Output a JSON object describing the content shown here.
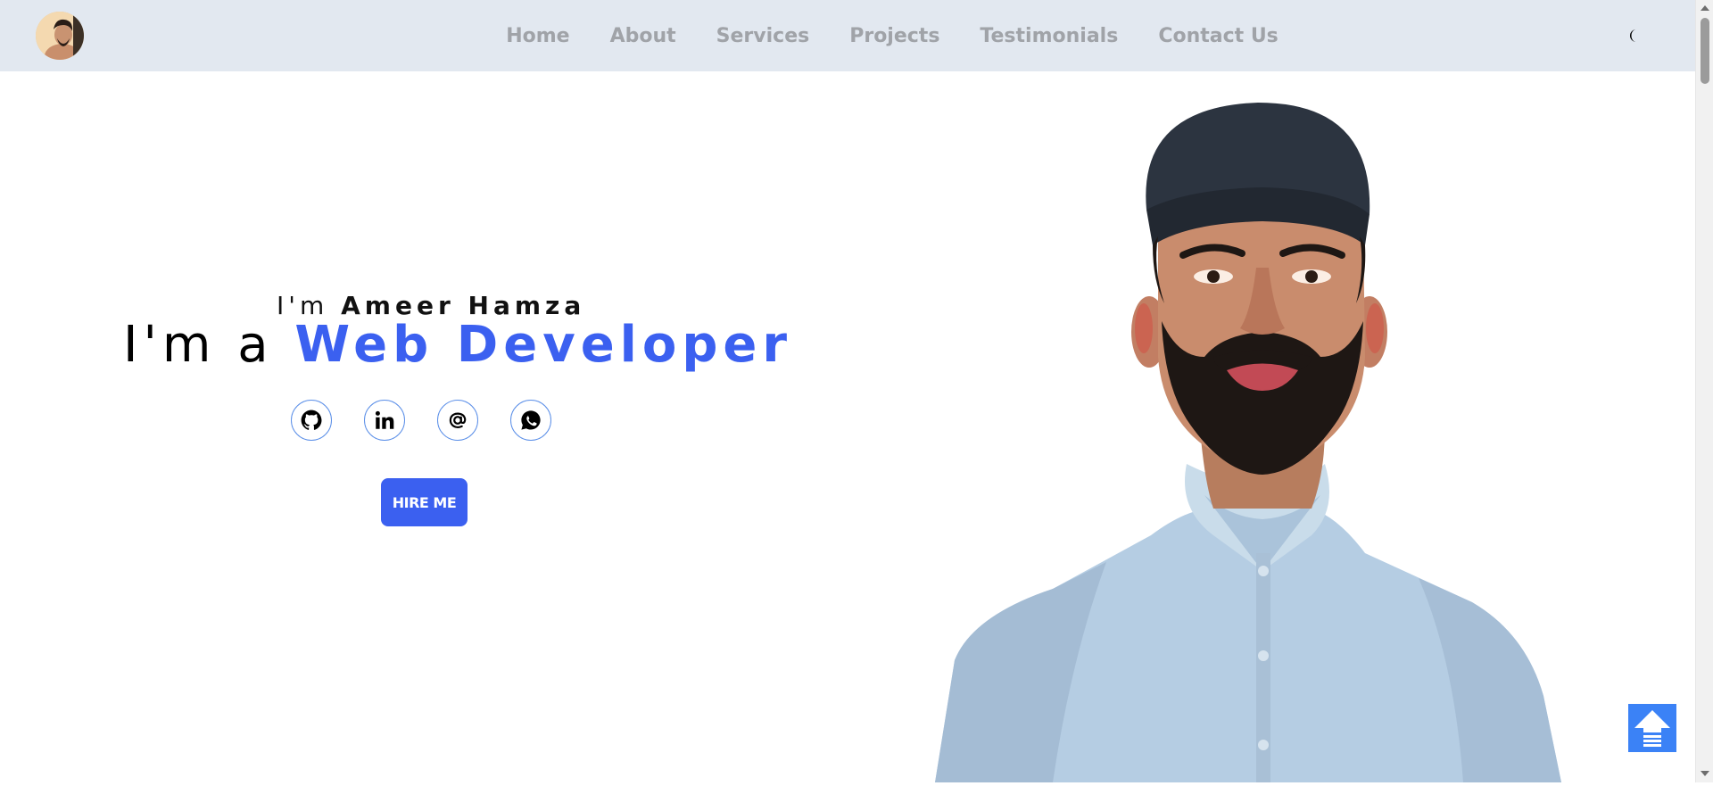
{
  "header": {
    "nav": [
      {
        "label": "Home"
      },
      {
        "label": "About"
      },
      {
        "label": "Services"
      },
      {
        "label": "Projects"
      },
      {
        "label": "Testimonials"
      },
      {
        "label": "Contact Us"
      }
    ],
    "theme_icon": "moon-icon",
    "avatar_icon": "profile-avatar"
  },
  "hero": {
    "greeting_prefix": "I'm",
    "name": "Ameer Hamza",
    "headline_prefix": "I'm a",
    "role": "Web Developer",
    "socials": [
      {
        "icon": "github-icon"
      },
      {
        "icon": "linkedin-icon"
      },
      {
        "icon": "email-icon"
      },
      {
        "icon": "whatsapp-icon"
      }
    ],
    "hire_label": "HIRE ME"
  },
  "colors": {
    "accent": "#3b60f0",
    "header_bg": "#e2e8f0",
    "nav_text": "#a0a3a8",
    "to_top": "#3b82f6"
  },
  "back_to_top_icon": "arrow-up-icon"
}
